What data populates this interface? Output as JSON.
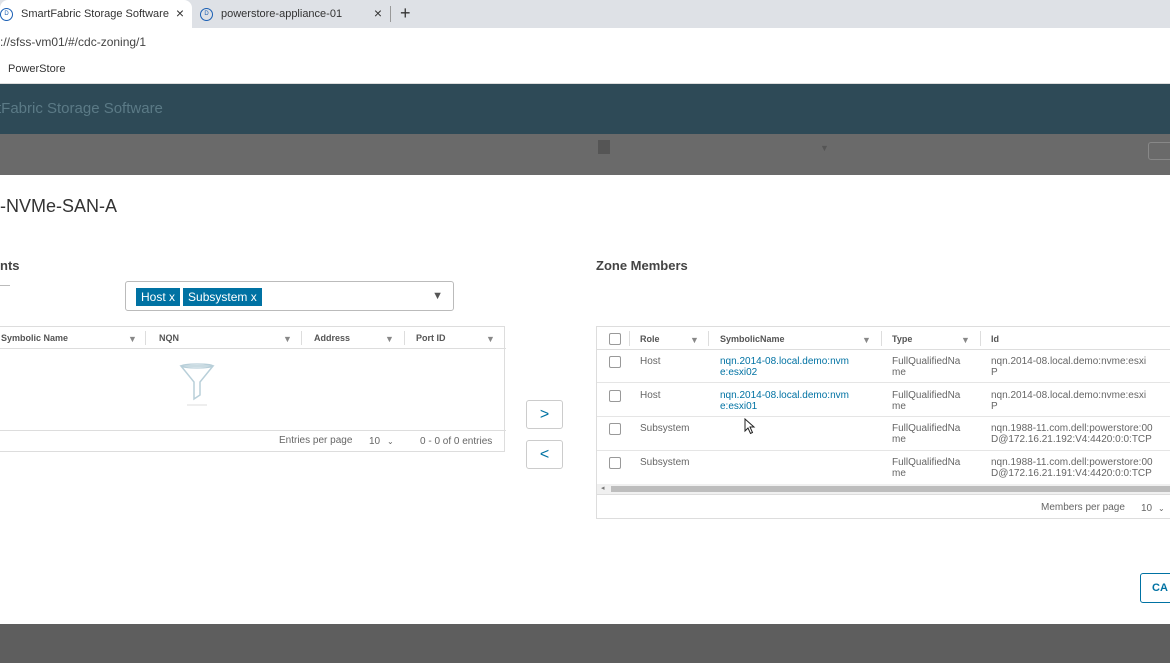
{
  "browser": {
    "tabs": [
      {
        "title": "SmartFabric Storage Software",
        "active": true
      },
      {
        "title": "powerstore-appliance-01",
        "active": false
      }
    ],
    "new_tab_label": "+",
    "close_label": "×",
    "url": "://sfss-vm01/#/cdc-zoning/1",
    "bookmark": "PowerStore"
  },
  "app": {
    "title": "rtFabric Storage Software"
  },
  "modal": {
    "title": "-NVMe-SAN-A",
    "left": {
      "heading": "nts",
      "filter_chips": [
        "Host x",
        "Subsystem x"
      ],
      "columns": [
        "Symbolic Name",
        "NQN",
        "Address",
        "Port ID"
      ],
      "entries_per_page_label": "Entries per page",
      "entries_per_page": "10",
      "range_text": "0 - 0 of 0 entries"
    },
    "move_right_label": ">",
    "move_left_label": "<",
    "right": {
      "heading": "Zone Members",
      "columns": [
        "Role",
        "SymbolicName",
        "Type",
        "Id"
      ],
      "rows": [
        {
          "role": "Host",
          "symbolic_name": [
            "nqn.2014-08.local.demo:nvm",
            "e:esxi02"
          ],
          "type": [
            "FullQualifiedNa",
            "me"
          ],
          "id": [
            "nqn.2014-08.local.demo:nvme:esxi",
            "P"
          ]
        },
        {
          "role": "Host",
          "symbolic_name": [
            "nqn.2014-08.local.demo:nvm",
            "e:esxi01"
          ],
          "type": [
            "FullQualifiedNa",
            "me"
          ],
          "id": [
            "nqn.2014-08.local.demo:nvme:esxi",
            "P"
          ]
        },
        {
          "role": "Subsystem",
          "symbolic_name": [
            "",
            ""
          ],
          "type": [
            "FullQualifiedNa",
            "me"
          ],
          "id": [
            "nqn.1988-11.com.dell:powerstore:00",
            "D@172.16.21.192:V4:4420:0:0:TCP"
          ]
        },
        {
          "role": "Subsystem",
          "symbolic_name": [
            "",
            ""
          ],
          "type": [
            "FullQualifiedNa",
            "me"
          ],
          "id": [
            "nqn.1988-11.com.dell:powerstore:00",
            "D@172.16.21.191:V4:4420:0:0:TCP"
          ]
        }
      ],
      "members_per_page_label": "Members per page",
      "members_per_page": "10"
    },
    "cancel_label": "CA"
  },
  "icons": {
    "filter": "filter-icon",
    "chevron": "chevron-down-icon",
    "funnel": "empty-funnel-icon"
  },
  "colors": {
    "accent": "#0072a3",
    "header": "#2e4a57"
  }
}
